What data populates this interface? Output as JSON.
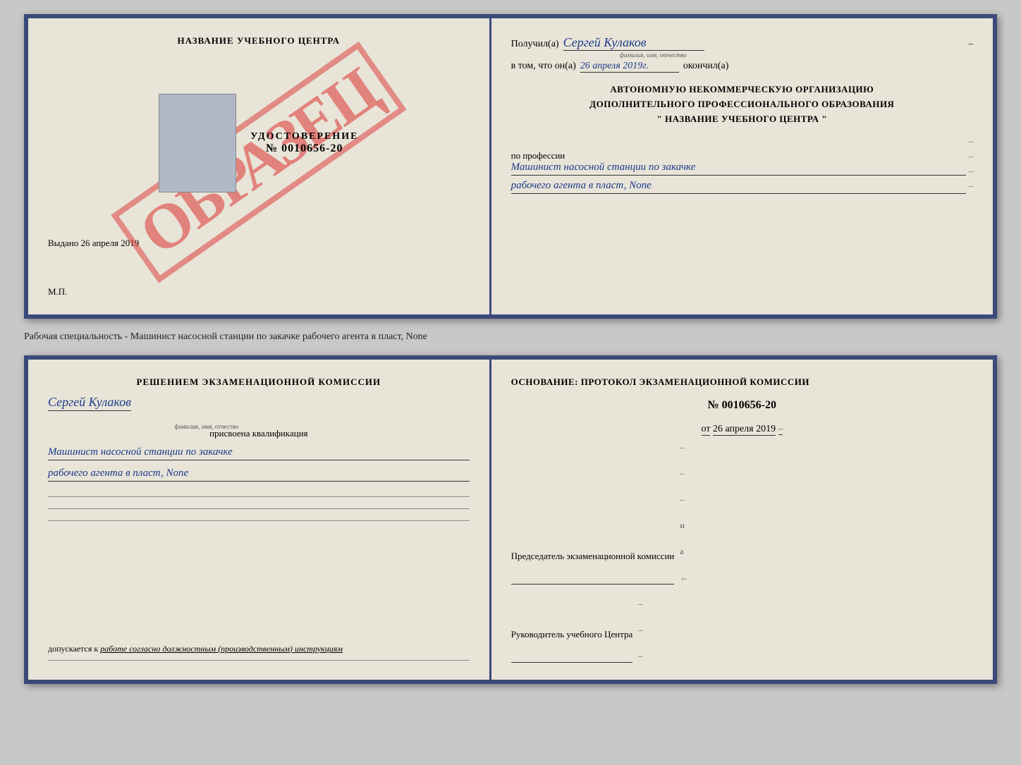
{
  "topLeft": {
    "title": "НАЗВАНИЕ УЧЕБНОГО ЦЕНТРА",
    "watermark": "ОБРАЗЕЦ",
    "udostoverenie": "УДОСТОВЕРЕНИЕ",
    "number": "№ 0010656-20",
    "vydano": "Выдано 26 апреля 2019",
    "mp": "М.П."
  },
  "topRight": {
    "poluchil_label": "Получил(а)",
    "poluchil_name": "Сергей Кулаков",
    "familiya_hint": "фамилия, имя, отчество",
    "dash1": "–",
    "vtom_label": "в том, что он(а)",
    "date": "26 апреля 2019г.",
    "okonchil": "окончил(а)",
    "org_line1": "АВТОНОМНУЮ НЕКОММЕРЧЕСКУЮ ОРГАНИЗАЦИЮ",
    "org_line2": "ДОПОЛНИТЕЛЬНОГО ПРОФЕССИОНАЛЬНОГО ОБРАЗОВАНИЯ",
    "org_line3": "\" НАЗВАНИЕ УЧЕБНОГО ЦЕНТРА \"",
    "po_professii": "по профессии",
    "profession_line1": "Машинист насосной станции по закачке",
    "profession_line2": "рабочего агента в пласт, None",
    "dashes": [
      "–",
      "–",
      "–",
      "–",
      "–"
    ]
  },
  "subtitle": "Рабочая специальность - Машинист насосной станции по закачке рабочего агента в пласт,\nNone",
  "bottomLeft": {
    "resheniem": "Решением экзаменационной комиссии",
    "name": "Сергей Кулаков",
    "familiya_hint": "фамилия, имя, отчество",
    "prisvoena": "присвоена квалификация",
    "qual_line1": "Машинист насосной станции по закачке",
    "qual_line2": "рабочего агента в пласт, None",
    "lines": [
      "___________________________",
      "___________________________",
      "___________________________"
    ],
    "dopusk": "допускается к",
    "dopusk_text": "работе согласно должностным (производственным) инструкциям",
    "bottom_line": "___________________________"
  },
  "bottomRight": {
    "osnovanie": "Основание: протокол экзаменационной комиссии",
    "number": "№ 0010656-20",
    "ot_label": "от",
    "date": "26 апреля 2019",
    "predsedatel": "Председатель экзаменационной комиссии",
    "rukovoditel": "Руководитель учебного Центра",
    "dashes": [
      "–",
      "–",
      "–",
      "и",
      "а",
      "←",
      "–",
      "–",
      "–",
      "–"
    ]
  }
}
